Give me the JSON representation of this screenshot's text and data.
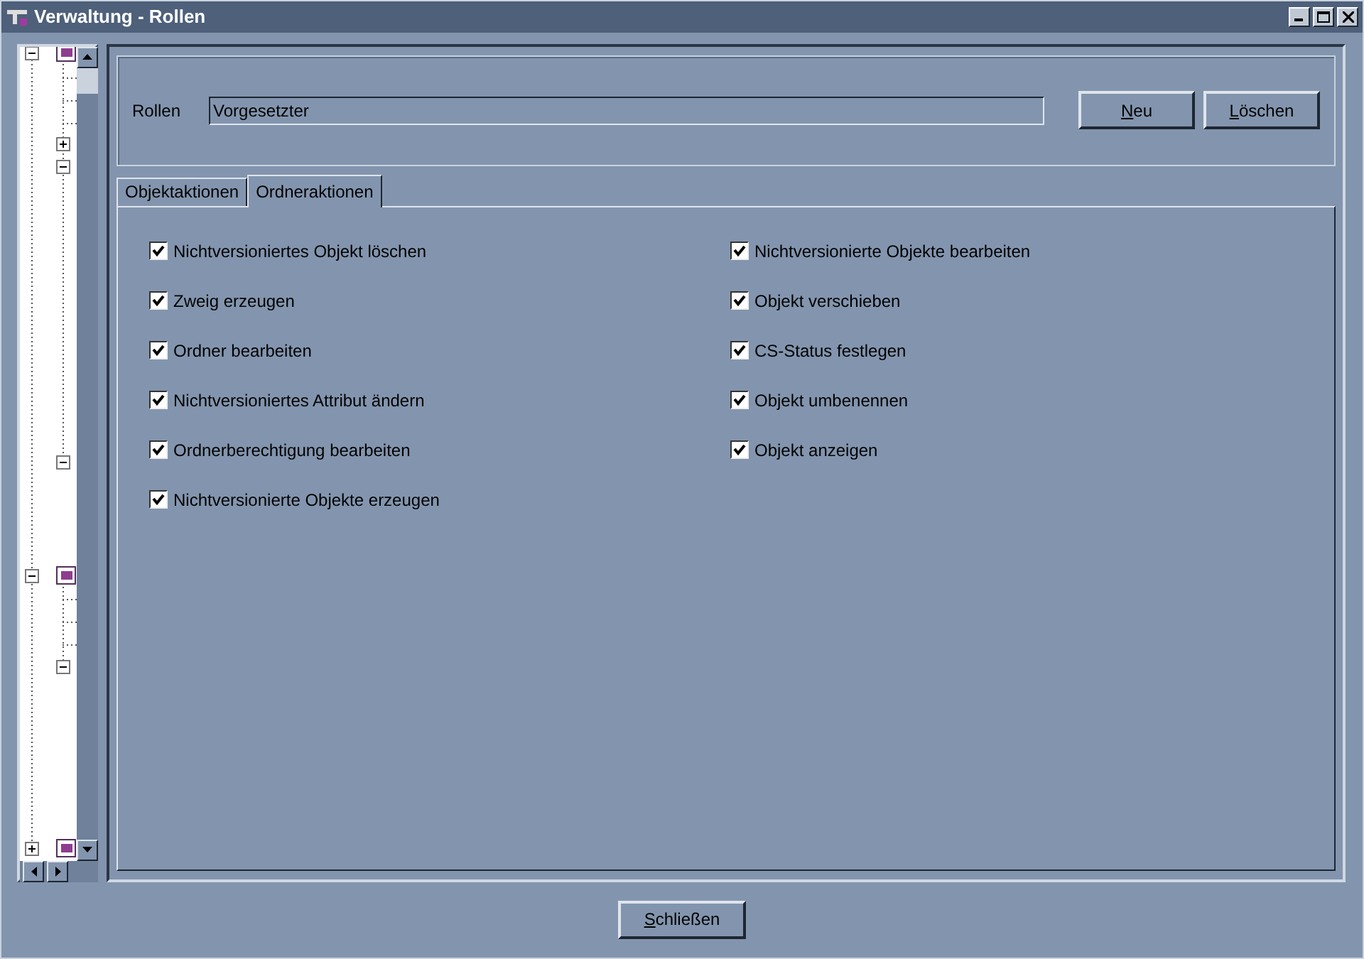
{
  "window": {
    "title": "Verwaltung - Rollen"
  },
  "role": {
    "label": "Rollen",
    "value": "Vorgesetzter"
  },
  "buttons": [
    {
      "label": "Neu",
      "underline_first": true
    },
    {
      "label": "Löschen",
      "underline_first": true
    }
  ],
  "tabs": [
    {
      "label": "Objektaktionen",
      "selected": false
    },
    {
      "label": "Ordneraktionen",
      "selected": true
    }
  ],
  "permissions_left": [
    {
      "label": "Nichtversioniertes Objekt löschen",
      "checked": true
    },
    {
      "label": "Zweig erzeugen",
      "checked": true
    },
    {
      "label": "Ordner bearbeiten",
      "checked": true
    },
    {
      "label": "Nichtversioniertes Attribut ändern",
      "checked": true
    },
    {
      "label": "Ordnerberechtigung bearbeiten",
      "checked": true
    },
    {
      "label": "Nichtversionierte Objekte erzeugen",
      "checked": true
    }
  ],
  "permissions_right": [
    {
      "label": "Nichtversionierte Objekte bearbeiten",
      "checked": true
    },
    {
      "label": "Objekt verschieben",
      "checked": true
    },
    {
      "label": "CS-Status festlegen",
      "checked": true
    },
    {
      "label": "Objekt umbenennen",
      "checked": true
    },
    {
      "label": "Objekt anzeigen",
      "checked": true
    }
  ],
  "close_button": {
    "label": "Schließen",
    "underline_first": true
  }
}
